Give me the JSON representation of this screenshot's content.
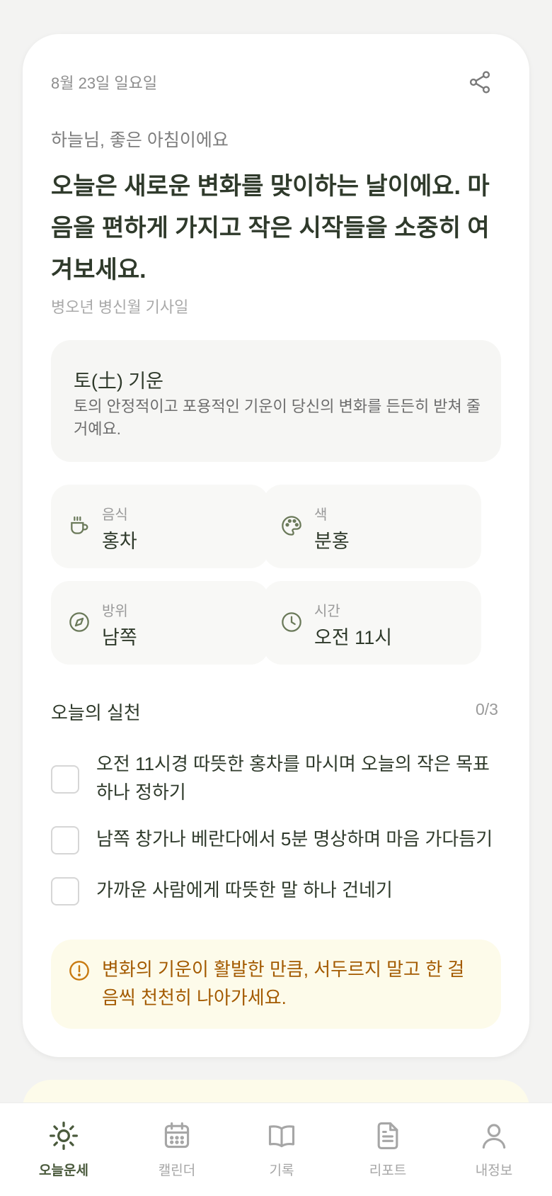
{
  "card": {
    "date": "8월 23일 일요일",
    "greeting": "하늘님, 좋은 아침이에요",
    "headline": "오늘은 새로운 변화를 맞이하는 날이에요. 마음을 편하게 가지고 작은 시작들을 소중히 여겨보세요.",
    "lunar_date": "병오년 병신월 기사일"
  },
  "element": {
    "title": "토(土) 기운",
    "description": "토의 안정적이고 포용적인 기운이 당신의 변화를 든든히 받쳐 줄 거예요."
  },
  "lucky": [
    {
      "label": "음식",
      "value": "홍차",
      "icon": "teacup-icon"
    },
    {
      "label": "색",
      "value": "분홍",
      "icon": "palette-icon"
    },
    {
      "label": "방위",
      "value": "남쪽",
      "icon": "compass-icon"
    },
    {
      "label": "시간",
      "value": "오전 11시",
      "icon": "clock-icon"
    }
  ],
  "practice": {
    "title": "오늘의 실천",
    "count": "0/3",
    "items": [
      {
        "text": "오전 11시경 따뜻한 홍차를 마시며 오늘의 작은 목표 하나 정하기",
        "checked": false
      },
      {
        "text": "남쪽 창가나 베란다에서 5분 명상하며 마음 가다듬기",
        "checked": false
      },
      {
        "text": "가까운 사람에게 따뜻한 말 하나 건네기",
        "checked": false
      }
    ]
  },
  "notice": {
    "text": "변화의 기운이 활발한 만큼, 서두르지 말고 한 걸음씩 천천히 나아가세요.",
    "icon": "alert-circle-icon"
  },
  "colors": {
    "accent": "#4a5a3c",
    "icon_olive": "#6b7a5a",
    "warning": "#a35a00",
    "notice_bg": "#fdfbea"
  },
  "tabs": [
    {
      "label": "오늘운세",
      "icon": "sun-icon",
      "active": true
    },
    {
      "label": "캘린더",
      "icon": "calendar-icon",
      "active": false
    },
    {
      "label": "기록",
      "icon": "book-icon",
      "active": false
    },
    {
      "label": "리포트",
      "icon": "document-icon",
      "active": false
    },
    {
      "label": "내정보",
      "icon": "user-icon",
      "active": false
    }
  ]
}
